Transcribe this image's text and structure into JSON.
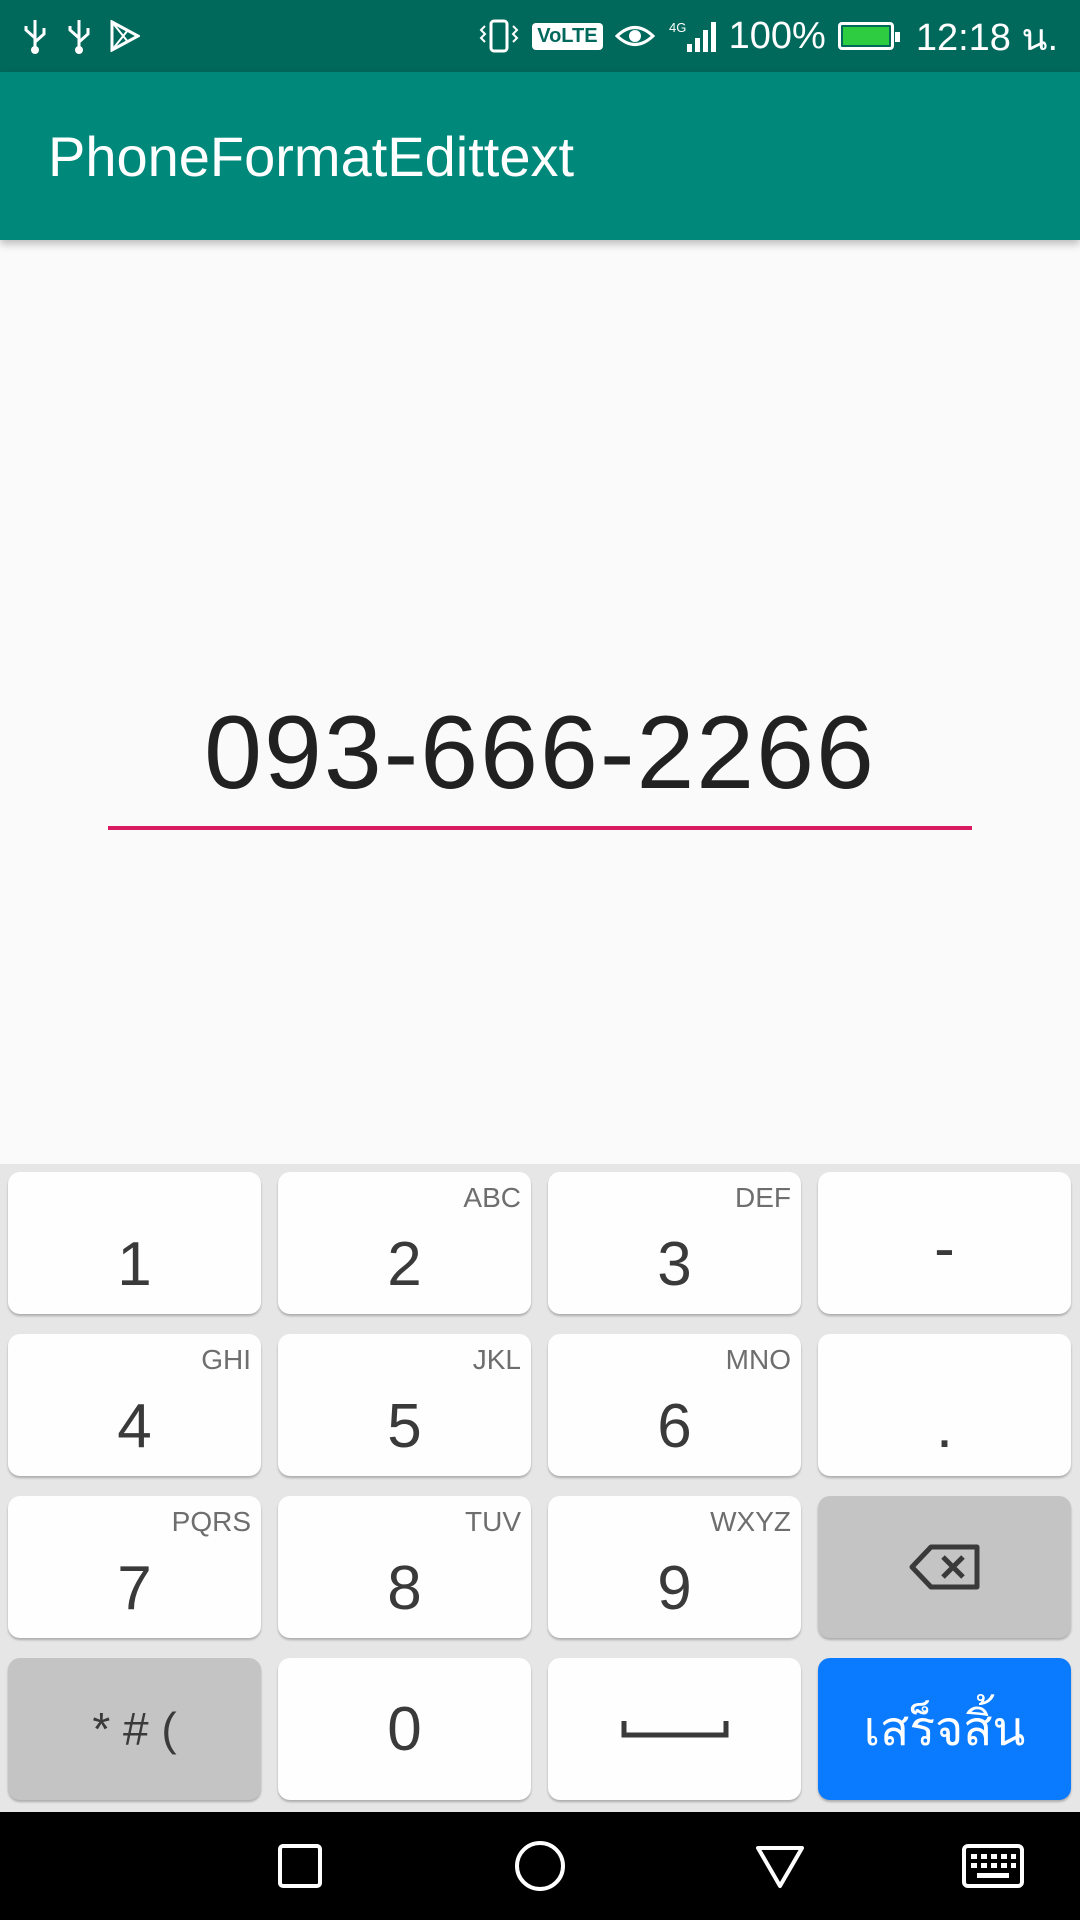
{
  "status_bar": {
    "battery_percent": "100%",
    "time": "12:18 น.",
    "volte_label": "VoLTE",
    "network_label": "4G",
    "battery_level": 1.0,
    "icons": [
      "usb-icon",
      "usb-icon",
      "play-store-icon",
      "vibrate-icon",
      "volte-icon",
      "eye-icon",
      "signal-icon",
      "battery-icon"
    ]
  },
  "app_bar": {
    "title": "PhoneFormatEdittext"
  },
  "phone_input": {
    "value": "093-666-2266",
    "underline_color": "#d81b60"
  },
  "keyboard": {
    "rows": [
      [
        {
          "main": "1",
          "sub": ""
        },
        {
          "main": "2",
          "sub": "ABC"
        },
        {
          "main": "3",
          "sub": "DEF"
        },
        {
          "main": "-",
          "sub": ""
        }
      ],
      [
        {
          "main": "4",
          "sub": "GHI"
        },
        {
          "main": "5",
          "sub": "JKL"
        },
        {
          "main": "6",
          "sub": "MNO"
        },
        {
          "main": ".",
          "sub": ""
        }
      ],
      [
        {
          "main": "7",
          "sub": "PQRS"
        },
        {
          "main": "8",
          "sub": "TUV"
        },
        {
          "main": "9",
          "sub": "WXYZ"
        },
        {
          "main": "",
          "sub": "",
          "icon": "backspace-icon"
        }
      ],
      [
        {
          "main": "* # (",
          "sub": ""
        },
        {
          "main": "0",
          "sub": ""
        },
        {
          "main": "",
          "sub": "",
          "icon": "space-icon"
        },
        {
          "main": "เสร็จสิ้น",
          "sub": ""
        }
      ]
    ],
    "done_color": "#0a7aff"
  },
  "nav_bar": {
    "buttons": [
      "recents-icon",
      "home-icon",
      "back-icon",
      "keyboard-icon"
    ]
  },
  "colors": {
    "status_bar": "#00695c",
    "app_bar": "#00897b",
    "background": "#fafafa"
  }
}
